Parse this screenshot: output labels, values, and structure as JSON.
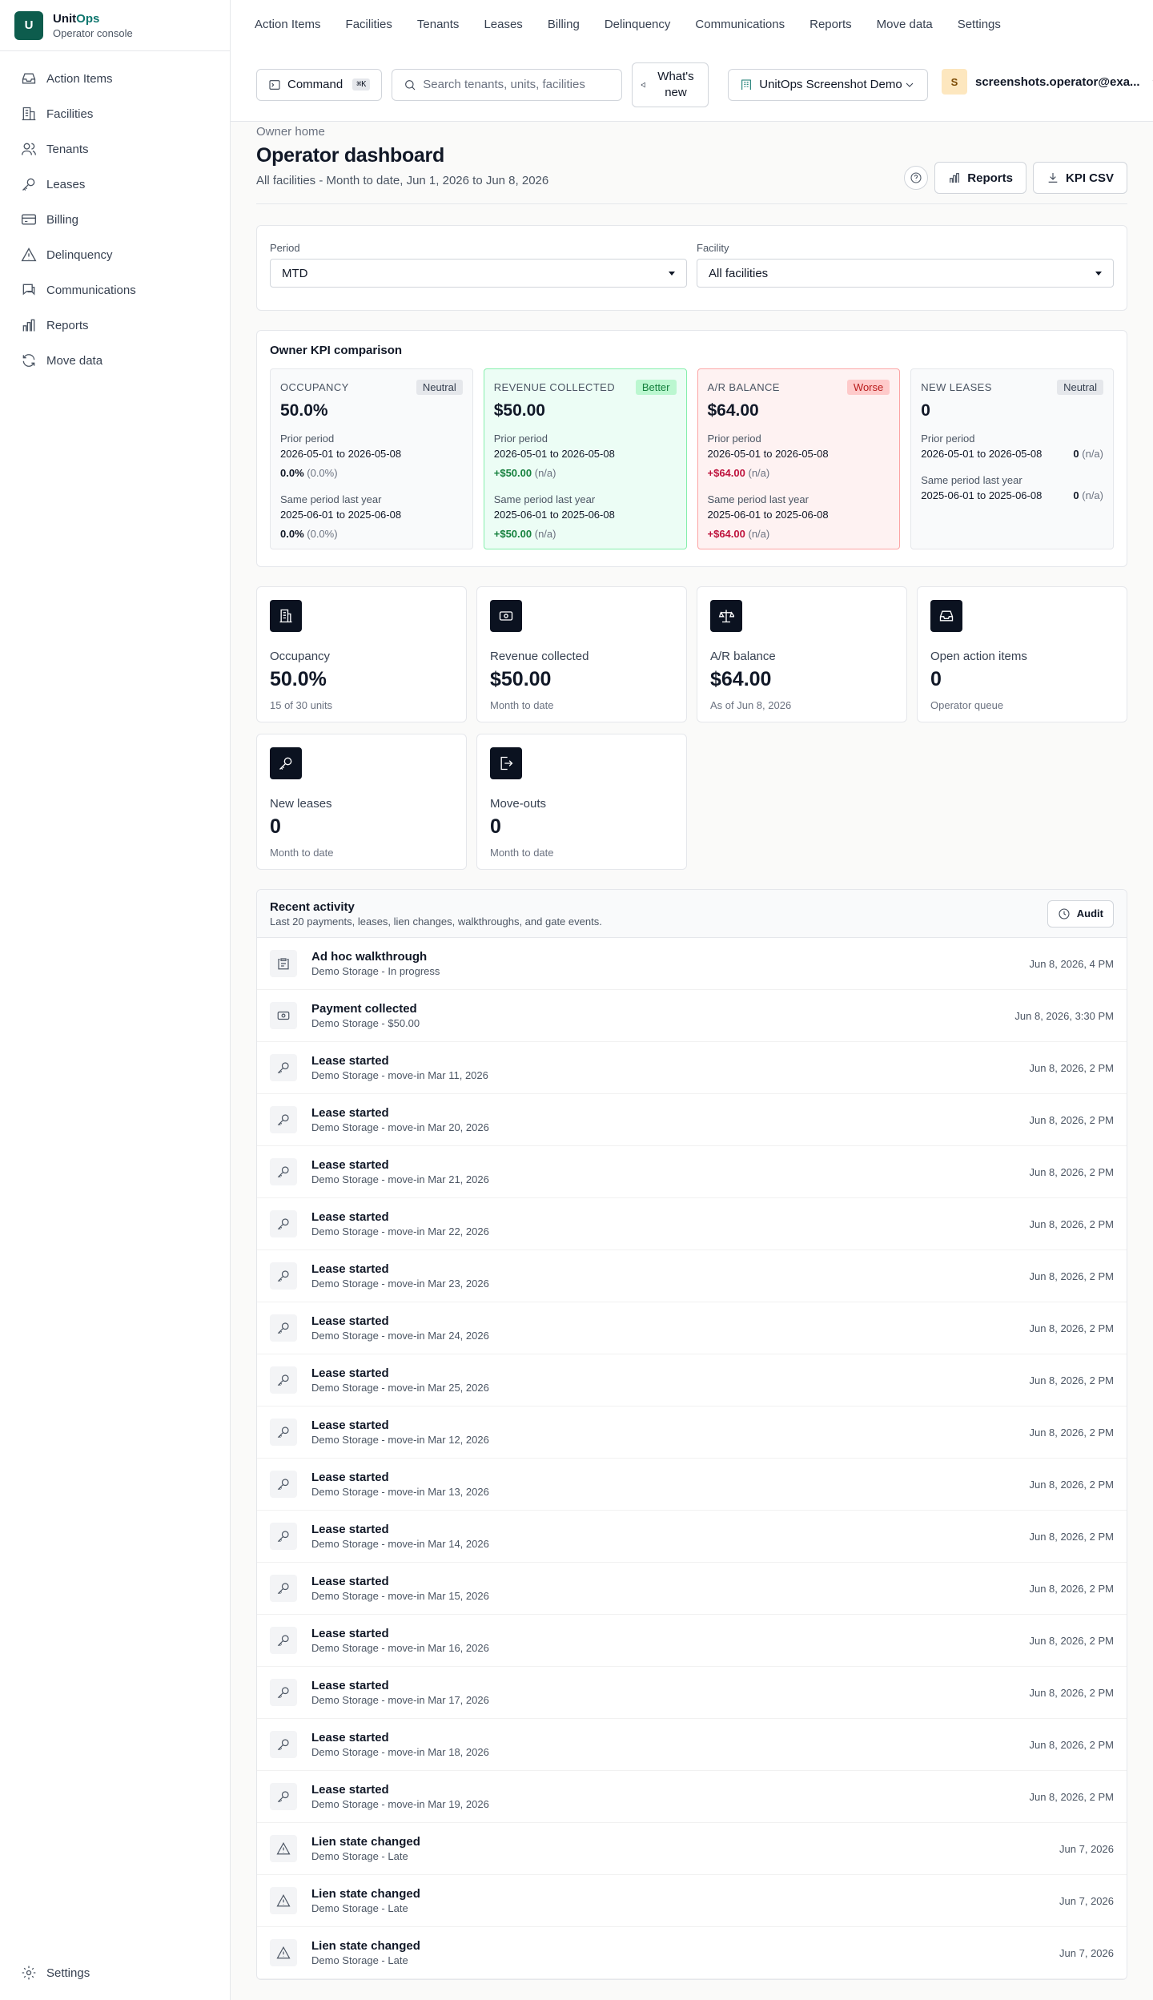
{
  "brand": {
    "logo_letter": "U",
    "name_a": "Unit",
    "name_b": "Ops",
    "subtitle": "Operator console"
  },
  "sidebar": {
    "items": [
      {
        "label": "Action Items",
        "icon": "inbox-icon"
      },
      {
        "label": "Facilities",
        "icon": "building-icon"
      },
      {
        "label": "Tenants",
        "icon": "users-icon"
      },
      {
        "label": "Leases",
        "icon": "key-icon"
      },
      {
        "label": "Billing",
        "icon": "credit-card-icon"
      },
      {
        "label": "Delinquency",
        "icon": "alert-triangle-icon"
      },
      {
        "label": "Communications",
        "icon": "message-icon"
      },
      {
        "label": "Reports",
        "icon": "bar-chart-icon"
      },
      {
        "label": "Move data",
        "icon": "refresh-icon"
      }
    ],
    "settings_label": "Settings"
  },
  "topnav": [
    "Action Items",
    "Facilities",
    "Tenants",
    "Leases",
    "Billing",
    "Delinquency",
    "Communications",
    "Reports",
    "Move data",
    "Settings"
  ],
  "toolbar": {
    "command_label": "Command",
    "command_kbd": "⌘K",
    "search_placeholder": "Search tenants, units, facilities",
    "whats_new": "What's new",
    "tenant_name": "UnitOps Screenshot Demo",
    "user_initial": "S",
    "user_email": "screenshots.operator@exa..."
  },
  "header": {
    "kicker": "Owner home",
    "title": "Operator dashboard",
    "subtitle": "All facilities - Month to date, Jun 1, 2026 to Jun 8, 2026",
    "reports_label": "Reports",
    "csv_label": "KPI CSV"
  },
  "filters": {
    "period_label": "Period",
    "period_value": "MTD",
    "facility_label": "Facility",
    "facility_value": "All facilities"
  },
  "kpi": {
    "title": "Owner KPI comparison",
    "prior_label": "Prior period",
    "prior_range": "2026-05-01 to 2026-05-08",
    "ly_label": "Same period last year",
    "ly_range": "2025-06-01 to 2025-06-08",
    "cards": [
      {
        "label": "OCCUPANCY",
        "badge": "Neutral",
        "value": "50.0%",
        "prior_delta": "0.0%",
        "prior_pct": "(0.0%)",
        "ly_delta": "0.0%",
        "ly_pct": "(0.0%)"
      },
      {
        "label": "REVENUE COLLECTED",
        "badge": "Better",
        "value": "$50.00",
        "prior_delta": "+$50.00",
        "prior_pct": "(n/a)",
        "ly_delta": "+$50.00",
        "ly_pct": "(n/a)"
      },
      {
        "label": "A/R BALANCE",
        "badge": "Worse",
        "value": "$64.00",
        "prior_delta": "+$64.00",
        "prior_pct": "(n/a)",
        "ly_delta": "+$64.00",
        "ly_pct": "(n/a)"
      },
      {
        "label": "NEW LEASES",
        "badge": "Neutral",
        "value": "0",
        "prior_delta": "0",
        "prior_pct": "(n/a)",
        "ly_delta": "0",
        "ly_pct": "(n/a)"
      }
    ]
  },
  "tiles": [
    {
      "label": "Occupancy",
      "value": "50.0%",
      "sub": "15 of 30 units",
      "icon": "building-icon"
    },
    {
      "label": "Revenue collected",
      "value": "$50.00",
      "sub": "Month to date",
      "icon": "banknote-icon"
    },
    {
      "label": "A/R balance",
      "value": "$64.00",
      "sub": "As of Jun 8, 2026",
      "icon": "scale-icon"
    },
    {
      "label": "Open action items",
      "value": "0",
      "sub": "Operator queue",
      "icon": "inbox-icon"
    },
    {
      "label": "New leases",
      "value": "0",
      "sub": "Month to date",
      "icon": "key-icon"
    },
    {
      "label": "Move-outs",
      "value": "0",
      "sub": "Month to date",
      "icon": "door-exit-icon"
    }
  ],
  "activity": {
    "title": "Recent activity",
    "subtitle": "Last 20 payments, leases, lien changes, walkthroughs, and gate events.",
    "audit_label": "Audit",
    "rows": [
      {
        "title": "Ad hoc walkthrough",
        "sub": "Demo Storage - In progress",
        "time": "Jun 8, 2026, 4 PM",
        "icon": "clipboard-icon"
      },
      {
        "title": "Payment collected",
        "sub": "Demo Storage - $50.00",
        "time": "Jun 8, 2026, 3:30 PM",
        "icon": "banknote-icon"
      },
      {
        "title": "Lease started",
        "sub": "Demo Storage - move-in Mar 11, 2026",
        "time": "Jun 8, 2026, 2 PM",
        "icon": "key-icon"
      },
      {
        "title": "Lease started",
        "sub": "Demo Storage - move-in Mar 20, 2026",
        "time": "Jun 8, 2026, 2 PM",
        "icon": "key-icon"
      },
      {
        "title": "Lease started",
        "sub": "Demo Storage - move-in Mar 21, 2026",
        "time": "Jun 8, 2026, 2 PM",
        "icon": "key-icon"
      },
      {
        "title": "Lease started",
        "sub": "Demo Storage - move-in Mar 22, 2026",
        "time": "Jun 8, 2026, 2 PM",
        "icon": "key-icon"
      },
      {
        "title": "Lease started",
        "sub": "Demo Storage - move-in Mar 23, 2026",
        "time": "Jun 8, 2026, 2 PM",
        "icon": "key-icon"
      },
      {
        "title": "Lease started",
        "sub": "Demo Storage - move-in Mar 24, 2026",
        "time": "Jun 8, 2026, 2 PM",
        "icon": "key-icon"
      },
      {
        "title": "Lease started",
        "sub": "Demo Storage - move-in Mar 25, 2026",
        "time": "Jun 8, 2026, 2 PM",
        "icon": "key-icon"
      },
      {
        "title": "Lease started",
        "sub": "Demo Storage - move-in Mar 12, 2026",
        "time": "Jun 8, 2026, 2 PM",
        "icon": "key-icon"
      },
      {
        "title": "Lease started",
        "sub": "Demo Storage - move-in Mar 13, 2026",
        "time": "Jun 8, 2026, 2 PM",
        "icon": "key-icon"
      },
      {
        "title": "Lease started",
        "sub": "Demo Storage - move-in Mar 14, 2026",
        "time": "Jun 8, 2026, 2 PM",
        "icon": "key-icon"
      },
      {
        "title": "Lease started",
        "sub": "Demo Storage - move-in Mar 15, 2026",
        "time": "Jun 8, 2026, 2 PM",
        "icon": "key-icon"
      },
      {
        "title": "Lease started",
        "sub": "Demo Storage - move-in Mar 16, 2026",
        "time": "Jun 8, 2026, 2 PM",
        "icon": "key-icon"
      },
      {
        "title": "Lease started",
        "sub": "Demo Storage - move-in Mar 17, 2026",
        "time": "Jun 8, 2026, 2 PM",
        "icon": "key-icon"
      },
      {
        "title": "Lease started",
        "sub": "Demo Storage - move-in Mar 18, 2026",
        "time": "Jun 8, 2026, 2 PM",
        "icon": "key-icon"
      },
      {
        "title": "Lease started",
        "sub": "Demo Storage - move-in Mar 19, 2026",
        "time": "Jun 8, 2026, 2 PM",
        "icon": "key-icon"
      },
      {
        "title": "Lien state changed",
        "sub": "Demo Storage - Late",
        "time": "Jun 7, 2026",
        "icon": "alert-triangle-icon"
      },
      {
        "title": "Lien state changed",
        "sub": "Demo Storage - Late",
        "time": "Jun 7, 2026",
        "icon": "alert-triangle-icon"
      },
      {
        "title": "Lien state changed",
        "sub": "Demo Storage - Late",
        "time": "Jun 7, 2026",
        "icon": "alert-triangle-icon"
      }
    ]
  }
}
